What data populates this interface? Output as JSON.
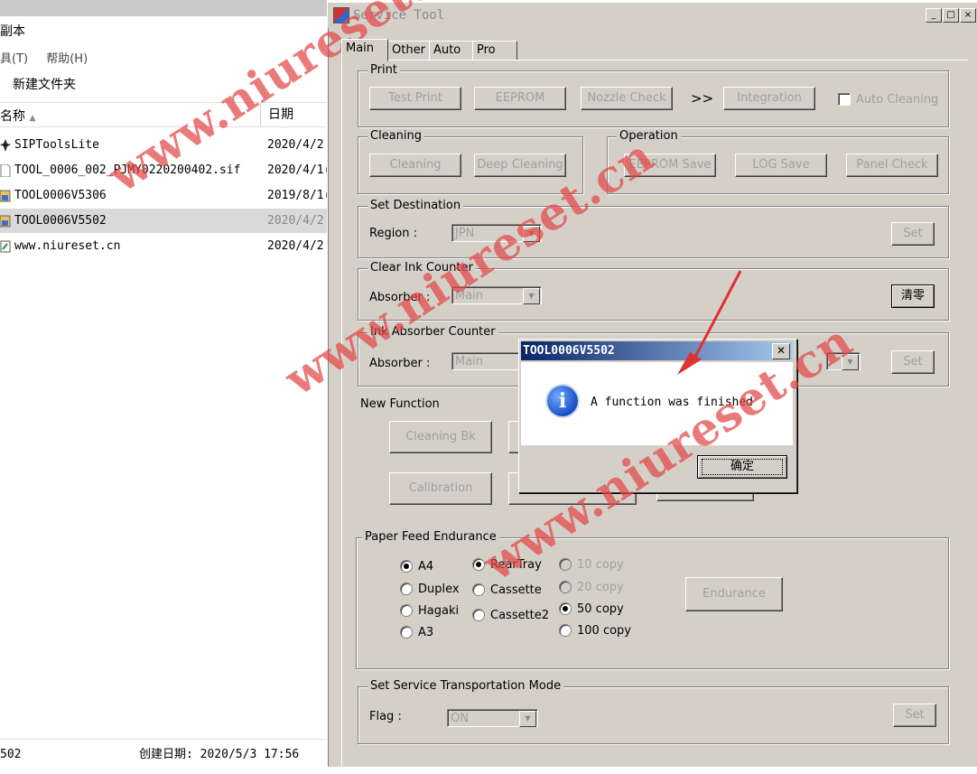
{
  "explorer": {
    "title_fragment": "副本",
    "menu": [
      "具(T)",
      "帮助(H)"
    ],
    "new_folder": "新建文件夹",
    "columns": {
      "name": "名称",
      "date": "日期"
    },
    "files": [
      {
        "name": "SIPToolsLite",
        "date": "2020/4/2",
        "icon": "app-icon"
      },
      {
        "name": "TOOL_0006_002_PJMY0220200402.sif",
        "date": "2020/4/1(",
        "icon": "file-icon"
      },
      {
        "name": "TOOL0006V5306",
        "date": "2019/8/1(",
        "icon": "tool-icon"
      },
      {
        "name": "TOOL0006V5502",
        "date": "2020/4/2",
        "icon": "tool-icon"
      },
      {
        "name": "www.niureset.cn",
        "date": "2020/4/2",
        "icon": "shortcut-icon"
      }
    ],
    "status_left": "502",
    "status_created": "创建日期: 2020/5/3 17:56"
  },
  "service_tool": {
    "title": "Service Tool",
    "tabs": [
      "Main",
      "Other",
      "Auto",
      "Pro"
    ],
    "print": {
      "title": "Print",
      "buttons": [
        "Test Print",
        "EEPROM",
        "Nozzle Check",
        "Integration"
      ],
      "arrows": ">>",
      "auto_cleaning": "Auto Cleaning"
    },
    "cleaning": {
      "title": "Cleaning",
      "buttons": [
        "Cleaning",
        "Deep Cleaning"
      ]
    },
    "operation": {
      "title": "Operation",
      "buttons": [
        "EEPROM Save",
        "LOG Save",
        "Panel Check"
      ]
    },
    "set_destination": {
      "title": "Set Destination",
      "label": "Region :",
      "value": "JPN",
      "button": "Set"
    },
    "clear_ink_counter": {
      "title": "Clear Ink Counter",
      "label": "Absorber :",
      "value": "Main",
      "button": "清零"
    },
    "ink_absorber_counter": {
      "title": "Ink Absorber Counter",
      "label": "Absorber :",
      "value": "Main",
      "button": "Set"
    },
    "new_function": {
      "title": "New Function",
      "buttons": [
        "Cleaning Bk",
        "Calibration"
      ]
    },
    "paper_feed": {
      "title": "Paper Feed Endurance",
      "sizes": [
        "A4",
        "Duplex",
        "Hagaki",
        "A3"
      ],
      "sources": [
        "RearTray",
        "Cassette",
        "Cassette2"
      ],
      "copies": [
        "10 copy",
        "20 copy",
        "50 copy",
        "100 copy"
      ],
      "selected_size": "A4",
      "selected_source": "RearTray",
      "selected_copy": "50 copy",
      "button": "Endurance"
    },
    "transport": {
      "title": "Set Service Transportation Mode",
      "label": "Flag :",
      "value": "ON",
      "button": "Set"
    }
  },
  "dialog": {
    "title": "TOOL0006V5502",
    "message": "A function was finished",
    "ok": "确定",
    "close": "✕"
  },
  "watermark": "www.niureset.cn",
  "colors": {
    "face": "#d4d0c8",
    "titlebar": "#0a246a",
    "watermark": "#e24646"
  }
}
